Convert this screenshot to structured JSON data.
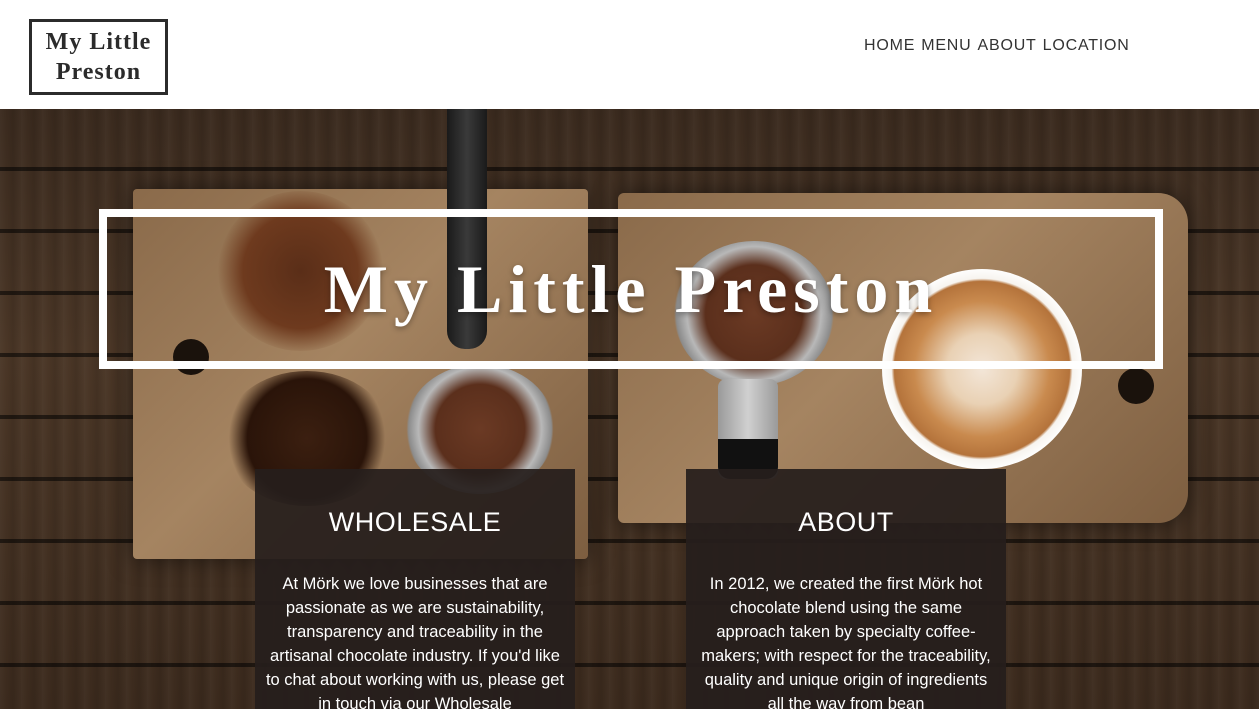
{
  "header": {
    "logo_line1": "My Little",
    "logo_line2": "Preston",
    "nav": [
      "HOME",
      "MENU",
      "ABOUT",
      "LOCATION"
    ]
  },
  "hero": {
    "title": "My Little Preston"
  },
  "cards": [
    {
      "title": "WHOLESALE",
      "body": "At Mörk we love businesses that are passionate as we are sustainability, transparency and traceability in the artisanal chocolate industry. If you'd like to chat about working with us, please get in touch via our Wholesale"
    },
    {
      "title": "ABOUT",
      "body": "In 2012, we created the first Mörk hot chocolate blend using the same approach taken by specialty coffee-makers; with respect for the traceability, quality and unique origin of ingredients all the way from bean"
    }
  ],
  "colors": {
    "card_bg": "#261e1c",
    "text_dark": "#333333",
    "text_light": "#ffffff"
  }
}
